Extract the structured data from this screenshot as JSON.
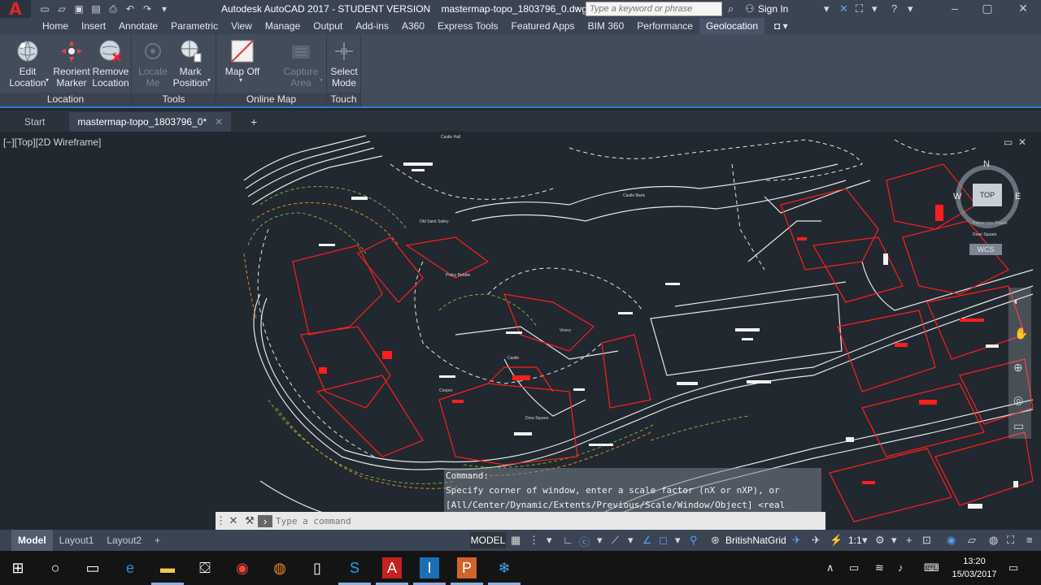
{
  "app": {
    "logo_letter": "A",
    "title": "Autodesk AutoCAD 2017 - STUDENT VERSION    mastermap-topo_1803796_0.dwg",
    "search_placeholder": "Type a keyword or phrase",
    "sign_in": "Sign In"
  },
  "ribbon_tabs": [
    "Home",
    "Insert",
    "Annotate",
    "Parametric",
    "View",
    "Manage",
    "Output",
    "Add-ins",
    "A360",
    "Express Tools",
    "Featured Apps",
    "BIM 360",
    "Performance",
    "Geolocation"
  ],
  "ribbon": {
    "location": {
      "title": "Location",
      "edit": "Edit\nLocation",
      "reorient": "Reorient\nMarker",
      "remove": "Remove\nLocation"
    },
    "tools": {
      "title": "Tools",
      "locate": "Locate\nMe",
      "mark": "Mark\nPosition"
    },
    "online_map": {
      "title": "Online Map",
      "map_off": "Map Off",
      "capture": "Capture\nArea"
    },
    "touch": {
      "title": "Touch",
      "select_mode": "Select\nMode"
    }
  },
  "doc_tabs": {
    "start": "Start",
    "active": "mastermap-topo_1803796_0*"
  },
  "viewport": {
    "label": "[−][Top][2D Wireframe]",
    "viewcube": {
      "n": "N",
      "s": "S",
      "e": "E",
      "w": "W",
      "top": "TOP",
      "wcs": "WCS"
    },
    "map_labels": [
      "Castle Hall",
      "Castle Bank",
      "Old Saint Sailey",
      "Pixley Bobble",
      "Castle",
      "Vinery",
      "Cooper",
      "Dora Square",
      "Palmerston Chapel",
      "Dean Square"
    ]
  },
  "command": {
    "history": [
      "Command:",
      "Specify corner of window, enter a scale factor (nX or nXP), or",
      "[All/Center/Dynamic/Extents/Previous/Scale/Window/Object] <real time>:"
    ],
    "placeholder": "Type a command"
  },
  "status": {
    "tabs": [
      "Model",
      "Layout1",
      "Layout2"
    ],
    "model_label": "MODEL",
    "coord_system": "BritishNatGrid",
    "scale": "1:1"
  },
  "taskbar": {
    "time": "13:20",
    "date": "15/03/2017"
  },
  "colors": {
    "accent": "#2a7bd3",
    "autocad_red": "#e0262a",
    "building_red": "#ff1e1e",
    "contour_green": "#6fb53a",
    "contour_orange": "#e08a22",
    "linework": "#e6e6e6"
  }
}
